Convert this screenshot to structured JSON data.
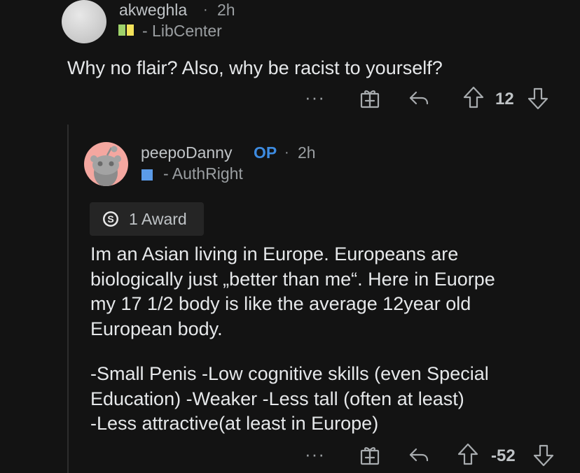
{
  "comments": [
    {
      "username": "akweghla",
      "separator": "·",
      "time": "2h",
      "flair_text": "- LibCenter",
      "flair_colors": [
        "#9fd26b",
        "#f3e25a"
      ],
      "body": "Why no flair? Also, why be racist to yourself?",
      "actions": {
        "more": "···",
        "vote_count": "12"
      }
    },
    {
      "username": "peepoDanny",
      "op_badge": "OP",
      "separator": "·",
      "time": "2h",
      "flair_text": "- AuthRight",
      "flair_colors": [
        "#5b9be8"
      ],
      "award_label": "1 Award",
      "body_lines": [
        "Im an Asian living in Europe. Europeans are",
        "biologically just „better than me“. Here in Euorpe",
        "my 17 1/2 body is like the average 12year old",
        "European body."
      ],
      "body_lines_2": [
        "-Small Penis -Low cognitive skills (even Special",
        "Education) -Weaker -Less tall (often at least)",
        "-Less attractive(at least in Europe)"
      ],
      "actions": {
        "more": "···",
        "vote_count": "-52"
      }
    }
  ],
  "colors": {
    "background": "#131313",
    "op": "#3d8be0",
    "text": "#e6e8ea",
    "muted": "#9a9ea1"
  },
  "icons": [
    "gift-icon",
    "reply-icon",
    "upvote-icon",
    "downvote-icon",
    "more-icon",
    "award-icon",
    "snoo-avatar-icon"
  ]
}
